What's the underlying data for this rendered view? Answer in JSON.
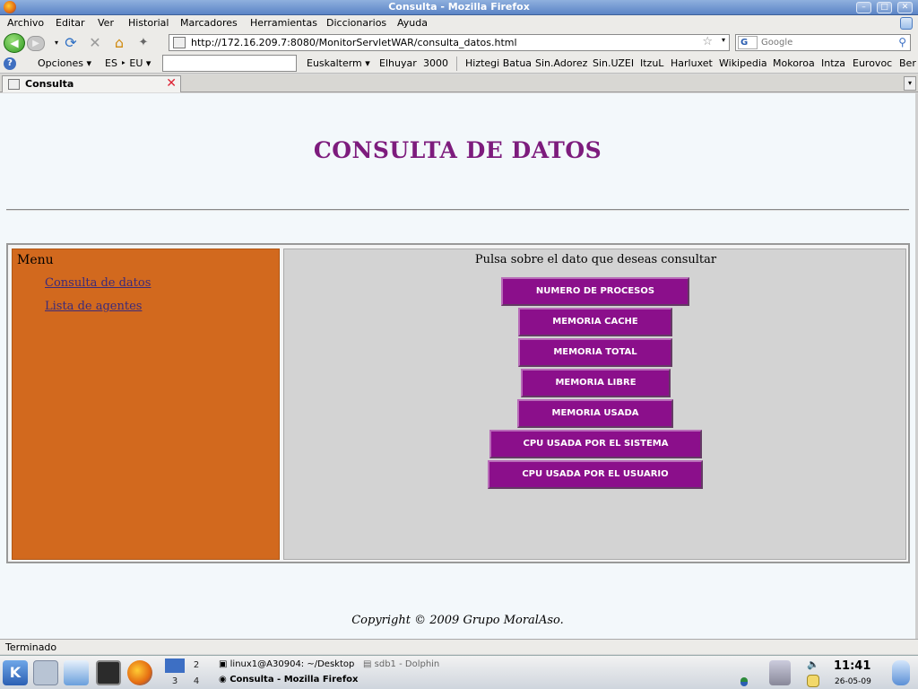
{
  "window": {
    "title": "Consulta - Mozilla Firefox",
    "buttons": {
      "minimize": "–",
      "maximize": "□",
      "close": "✕"
    }
  },
  "menubar": [
    "Archivo",
    "Editar",
    "Ver",
    "Historial",
    "Marcadores",
    "Herramientas",
    "Diccionarios",
    "Ayuda"
  ],
  "navbar": {
    "url": "http://172.16.209.7:8080/MonitorServletWAR/consulta_datos.html",
    "search_engine": "G",
    "search_placeholder": "Google"
  },
  "bookmarks": {
    "opciones": "Opciones ▾",
    "lang": "ES ‣ EU ▾",
    "items": [
      "Euskalterm ▾",
      "Elhuyar",
      "3000",
      "Hiztegi Batua",
      "Sin.Adorez",
      "Sin.UZEI",
      "ItzuL",
      "Harluxet",
      "Wikipedia",
      "Mokoroa",
      "Intza",
      "Eurovoc",
      "Ber"
    ]
  },
  "tab": {
    "label": "Consulta"
  },
  "page": {
    "title": "CONSULTA DE DATOS",
    "menu_heading": "Menu",
    "menu_links": [
      "Consulta de datos",
      "Lista de agentes"
    ],
    "prompt": "Pulsa sobre el dato que deseas consultar",
    "buttons": [
      "NUMERO DE PROCESOS",
      "MEMORIA CACHE",
      "MEMORIA TOTAL",
      "MEMORIA LIBRE",
      "MEMORIA USADA",
      "CPU USADA POR EL SISTEMA",
      "CPU USADA POR EL USUARIO"
    ],
    "copyright": "Copyright © 2009 Grupo MoralAso."
  },
  "status": "Terminado",
  "taskbar": {
    "desktops": [
      "2",
      "3",
      "4"
    ],
    "tasks": [
      "linux1@A30904: ~/Desktop",
      "sdb1 - Dolphin",
      "Consulta - Mozilla Firefox"
    ],
    "time": "11:41",
    "date": "26-05-09"
  },
  "colors": {
    "title_purple": "#7d1c7d",
    "button_purple": "#8b0f8b",
    "menu_orange": "#d2691e",
    "main_gray": "#d3d3d3"
  }
}
